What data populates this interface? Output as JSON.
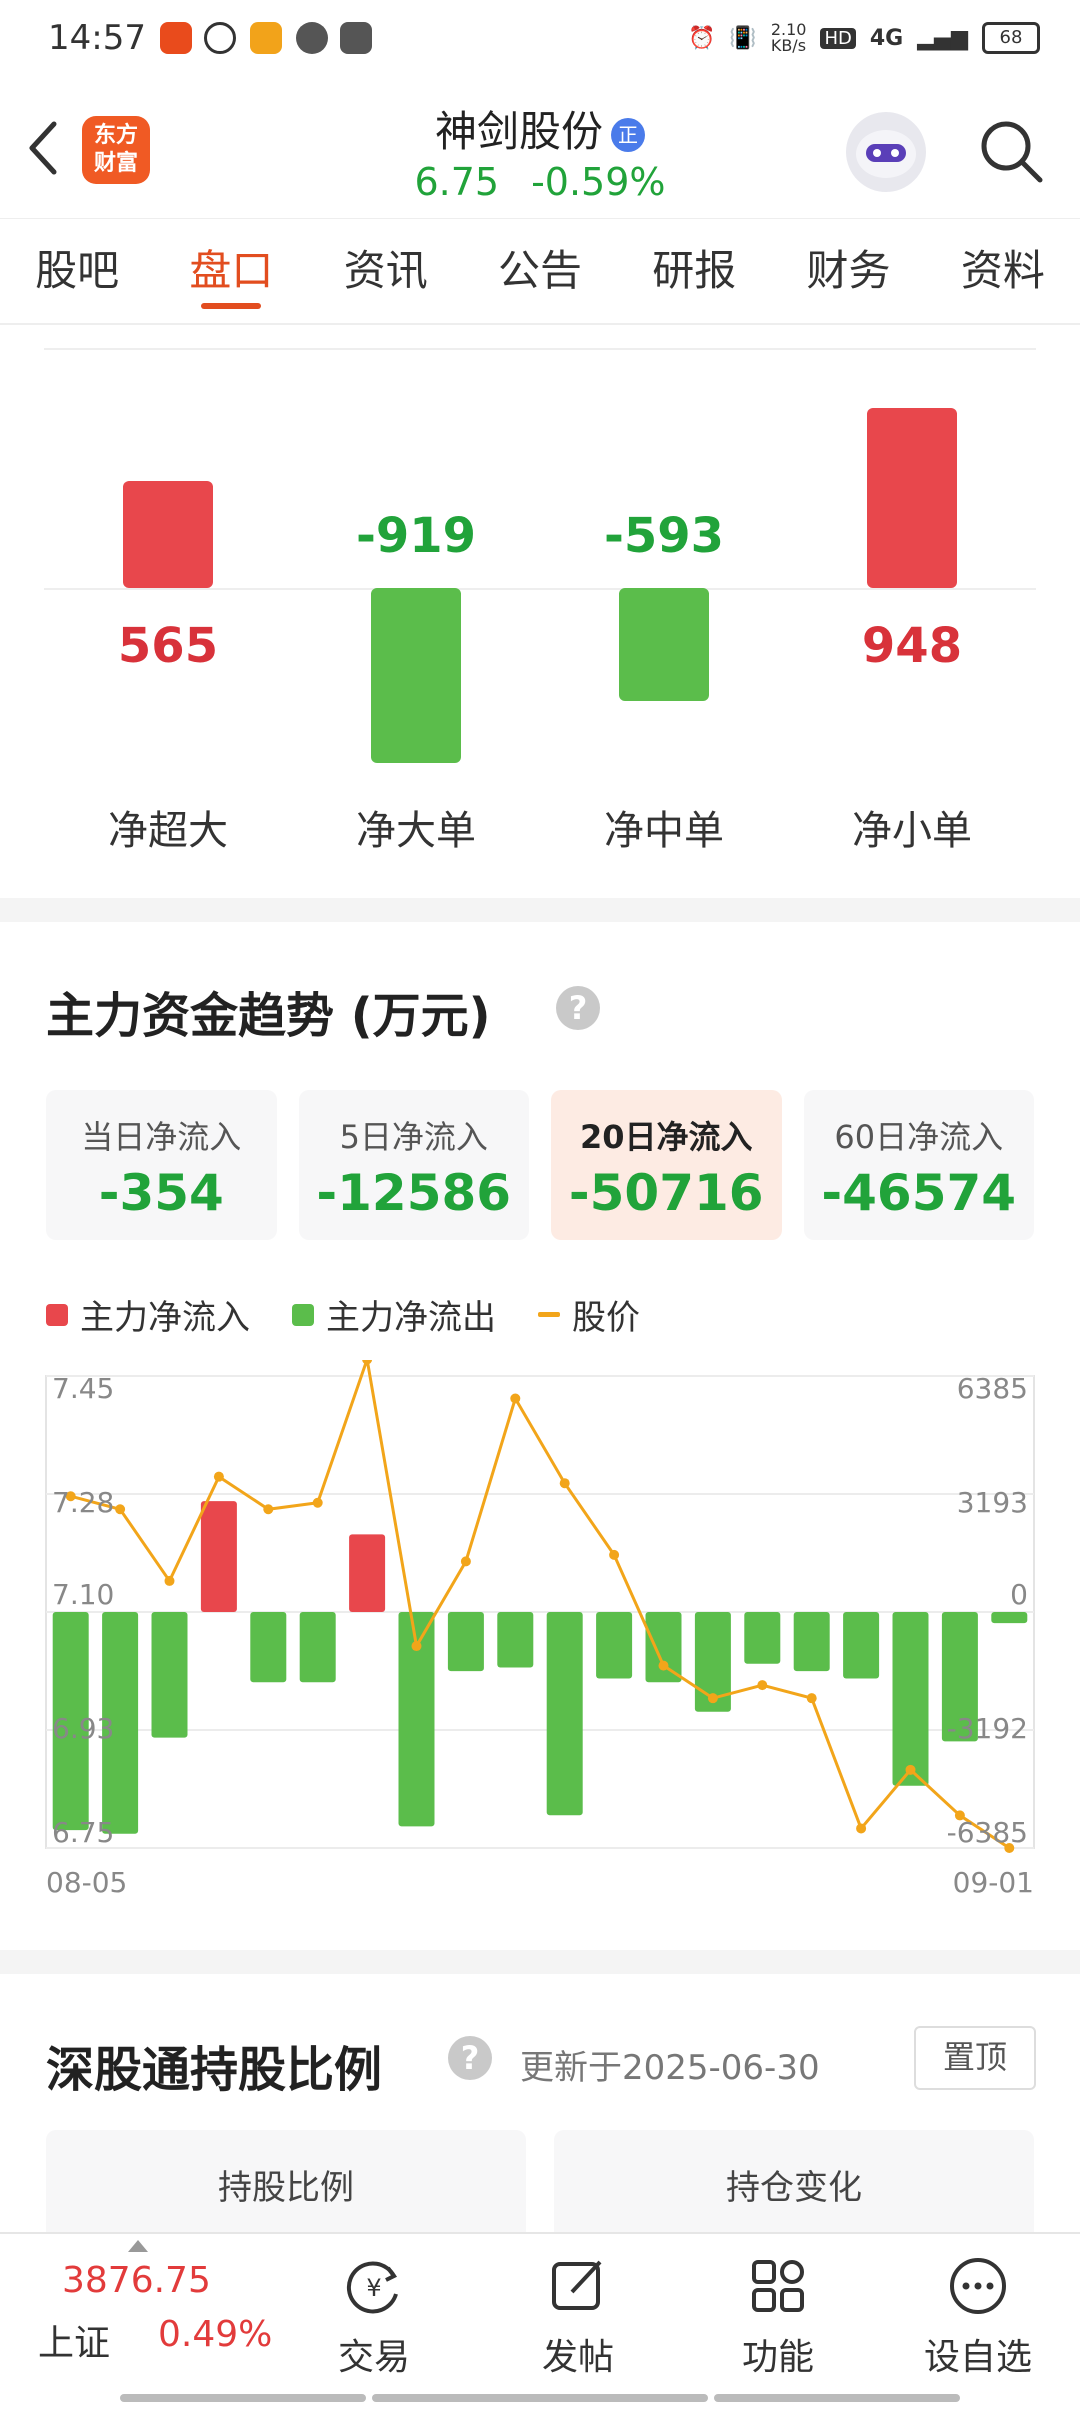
{
  "status_bar": {
    "time": "14:57",
    "net_speed": "2.10\nKB/s",
    "net_type": "4G",
    "battery": "68"
  },
  "header": {
    "logo_text": "东方\n财富",
    "stock_name": "神剑股份",
    "badge": "正",
    "price": "6.75",
    "change": "-0.59%"
  },
  "tabs": [
    {
      "label": "股吧",
      "active": false
    },
    {
      "label": "盘口",
      "active": true
    },
    {
      "label": "资讯",
      "active": false
    },
    {
      "label": "公告",
      "active": false
    },
    {
      "label": "研报",
      "active": false
    },
    {
      "label": "财务",
      "active": false
    },
    {
      "label": "资料",
      "active": false
    }
  ],
  "net_flow": {
    "items": [
      {
        "label": "净超大",
        "value": 565,
        "display": "565"
      },
      {
        "label": "净大单",
        "value": -919,
        "display": "-919"
      },
      {
        "label": "净中单",
        "value": -593,
        "display": "-593"
      },
      {
        "label": "净小单",
        "value": 948,
        "display": "948"
      }
    ]
  },
  "trend": {
    "title": "主力资金趋势 (万元)",
    "help": "?",
    "cards": [
      {
        "label": "当日净流入",
        "value": "-354",
        "selected": false
      },
      {
        "label": "5日净流入",
        "value": "-12586",
        "selected": false
      },
      {
        "label": "20日净流入",
        "value": "-50716",
        "selected": true
      },
      {
        "label": "60日净流入",
        "value": "-46574",
        "selected": false
      }
    ],
    "legend": [
      "主力净流入",
      "主力净流出",
      "股价"
    ]
  },
  "chart_data": {
    "type": "bar",
    "x_start": "08-05",
    "x_end": "09-01",
    "bar_values": [
      -5900,
      -6000,
      -3400,
      3000,
      -1900,
      -1900,
      2100,
      -5800,
      -1600,
      -1500,
      -5500,
      -1800,
      -1900,
      -2700,
      -1400,
      -1600,
      -1800,
      -4700,
      -3500,
      -300
    ],
    "price_values": [
      7.29,
      7.27,
      7.16,
      7.32,
      7.27,
      7.28,
      7.5,
      7.06,
      7.19,
      7.44,
      7.31,
      7.2,
      7.03,
      6.98,
      7.0,
      6.98,
      6.78,
      6.87,
      6.8,
      6.75
    ],
    "left_axis": [
      "7.45",
      "7.28",
      "7.10",
      "6.93",
      "6.75"
    ],
    "right_axis": [
      "6385",
      "3193",
      "0",
      "-3192",
      "-6385"
    ],
    "left_range": [
      6.75,
      7.45
    ],
    "right_range": [
      -6385,
      6385
    ],
    "colors": {
      "inflow": "#e8474c",
      "outflow": "#5bbd4b",
      "price": "#f2a51a"
    }
  },
  "hk_connect": {
    "title": "深股通持股比例",
    "help": "?",
    "updated": "更新于2025-06-30",
    "pin": "置顶",
    "cards": [
      "持股比例",
      "持仓变化"
    ]
  },
  "bottom_bar": {
    "index_value": "3876.75",
    "index_name": "上证",
    "index_change": "0.49%",
    "items": [
      {
        "label": "交易",
        "icon": "trade-icon"
      },
      {
        "label": "发帖",
        "icon": "post-icon"
      },
      {
        "label": "功能",
        "icon": "grid-icon"
      },
      {
        "label": "设自选",
        "icon": "more-icon"
      }
    ]
  }
}
